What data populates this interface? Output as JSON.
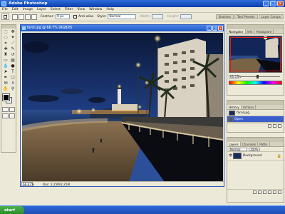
{
  "app": {
    "title": "Adobe Photoshop",
    "window_buttons": [
      "_",
      "□",
      "×"
    ]
  },
  "menu": [
    "File",
    "Edit",
    "Image",
    "Layer",
    "Select",
    "Filter",
    "View",
    "Window",
    "Help"
  ],
  "options_bar": {
    "feather_label": "Feather:",
    "feather_value": "0 px",
    "antialias_label": "Anti-alias",
    "style_label": "Style:",
    "style_value": "Normal",
    "width_label": "Width:",
    "height_label": "Height:",
    "palette_well_tabs": [
      "Brushes",
      "Tool Presets",
      "Layer Comps"
    ]
  },
  "document": {
    "title": "farol.jpg @ 66.7% (RGB/8)",
    "zoom": "66.67%",
    "info": "Doc: 2,25M/2,25M",
    "buttons": [
      "_",
      "□",
      "×"
    ]
  },
  "navigator": {
    "tabs": [
      "Navigator",
      "Info",
      "Histogram"
    ],
    "zoom": "66.67%",
    "zoom_level": 0.4
  },
  "history": {
    "tabs": [
      "History",
      "Actions"
    ],
    "items": [
      {
        "label": "farol.jpg"
      },
      {
        "label": "Open",
        "selected": true
      }
    ]
  },
  "layers": {
    "tabs": [
      "Layers",
      "Channels",
      "Paths"
    ],
    "blend": "Normal",
    "opacity": "100%",
    "items": [
      {
        "label": "Background",
        "selected": false
      }
    ]
  },
  "taskbar": {
    "start_label": "start"
  },
  "colors": {
    "titlebar": "#0a3fb0",
    "accent": "#3a5fcd",
    "close": "#d9532a",
    "taskbar": "#1f4fb3",
    "start": "#2a8a2a"
  }
}
